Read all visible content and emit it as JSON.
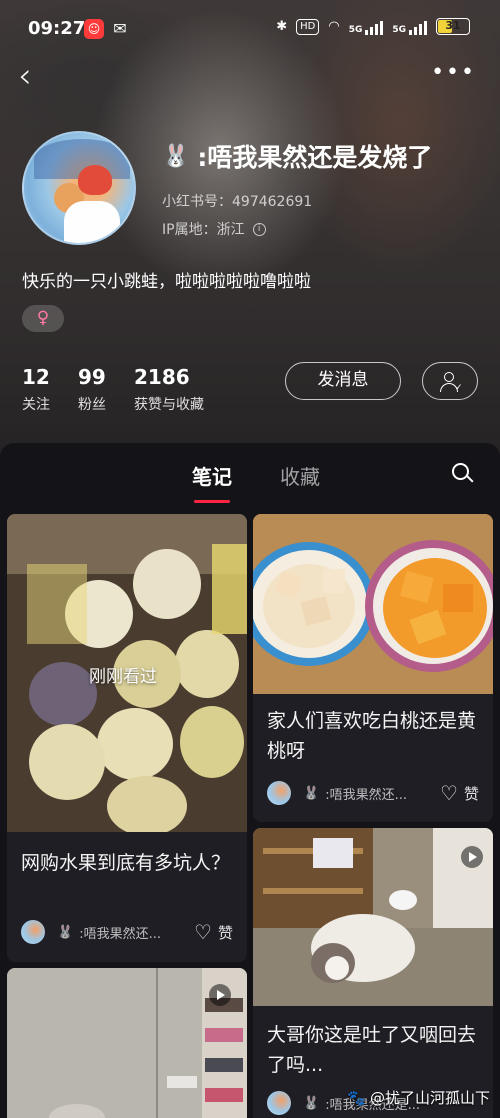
{
  "status_bar": {
    "time": "09:27",
    "right_icons": [
      "bluetooth-icon",
      "hd-icon",
      "wifi-icon",
      "5g-signal-icon",
      "5g-signal-icon"
    ],
    "hd_label": "HD",
    "signal1_label": "5G",
    "signal2_label": "5G",
    "battery": "31"
  },
  "nav": {
    "back_icon": "‹",
    "more_icon": "•••"
  },
  "profile": {
    "nickname_emoji": "🐰",
    "nickname": ":唔我果然还是发烧了",
    "red_id": "小红书号：497462691",
    "ip": "IP属地：浙江",
    "info_icon": "i",
    "bio": "快乐的一只小跳蛙，啦啦啦啦啦噜啦啦",
    "gender": "♀"
  },
  "stats": [
    {
      "value": "12",
      "label": "关注"
    },
    {
      "value": "99",
      "label": "粉丝"
    },
    {
      "value": "2186",
      "label": "获赞与收藏"
    }
  ],
  "actions": {
    "message": "发消息"
  },
  "tabs": {
    "notes": "笔记",
    "favorites": "收藏"
  },
  "cards": [
    {
      "title": "网购水果到底有多坑人？",
      "author_emoji": "🐰",
      "author": ":唔我果然还...",
      "like": "赞",
      "badge": "刚刚看过"
    },
    {
      "title": "家人们喜欢吃白桃还是黄桃呀",
      "author_emoji": "🐰",
      "author": ":唔我果然还...",
      "like": "赞"
    },
    {
      "title": "大哥你这是吐了又咽回去了吗...",
      "author_emoji": "🐰",
      "author": ":唔我果然还是...",
      "like": "赞"
    }
  ],
  "watermark": "@扰了山河孤山下",
  "colors": {
    "accent": "#ff2442",
    "panel": "#141318",
    "card": "#1f1e24"
  }
}
